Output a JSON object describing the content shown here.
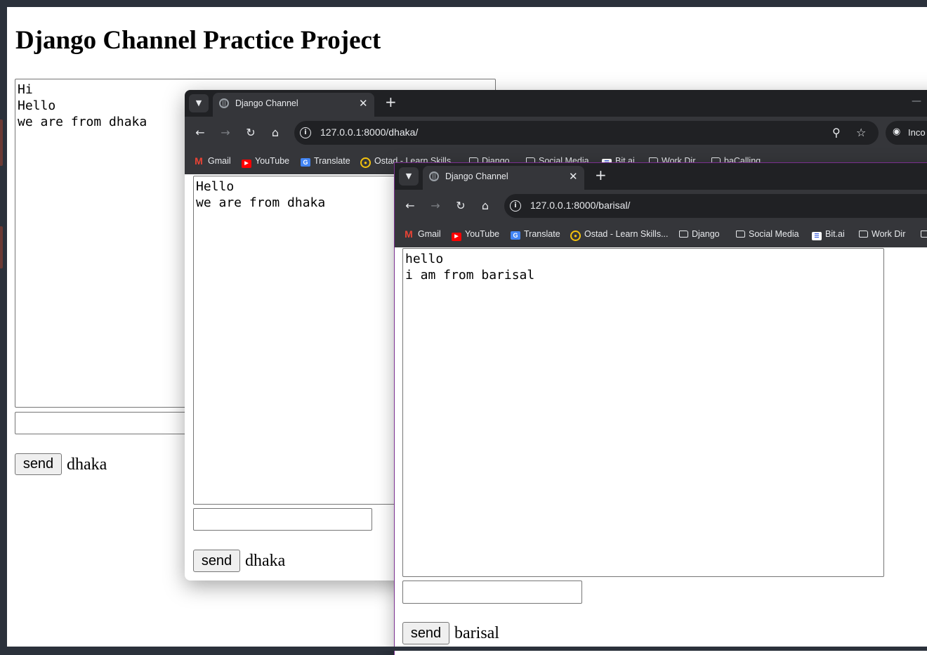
{
  "main_page": {
    "title": "Django Channel Practice Project",
    "log_lines": [
      "Hi",
      "Hello",
      "we are from dhaka"
    ],
    "send_label": "send",
    "room_name": "dhaka"
  },
  "window_dhaka": {
    "tab_title": "Django Channel",
    "url": "127.0.0.1:8000/dhaka/",
    "incognito_label": "Inco",
    "bookmarks": [
      "Gmail",
      "YouTube",
      "Translate",
      "Ostad - Learn Skills...",
      "Django",
      "Social Media",
      "Bit.ai",
      "Work Dir",
      "baCalling"
    ],
    "log_lines": [
      "Hello",
      "we are from dhaka"
    ],
    "send_label": "send",
    "room_name": "dhaka"
  },
  "window_barisal": {
    "tab_title": "Django Channel",
    "url": "127.0.0.1:8000/barisal/",
    "bookmarks": [
      "Gmail",
      "YouTube",
      "Translate",
      "Ostad - Learn Skills...",
      "Django",
      "Social Media",
      "Bit.ai",
      "Work Dir"
    ],
    "log_lines": [
      "hello",
      "i am from barisal"
    ],
    "send_label": "send",
    "room_name": "barisal"
  },
  "icons": [
    "tab-search-chevron-icon",
    "globe-icon",
    "close-icon",
    "plus-icon",
    "back-icon",
    "forward-icon",
    "reload-icon",
    "home-icon",
    "info-icon",
    "zoom-icon",
    "star-icon",
    "incognito-icon",
    "folder-icon"
  ],
  "colors": {
    "browser_frame": "#202124",
    "toolbar": "#35363a",
    "desktop": "#2b313b",
    "incognito_border": "#7a2f8f"
  }
}
